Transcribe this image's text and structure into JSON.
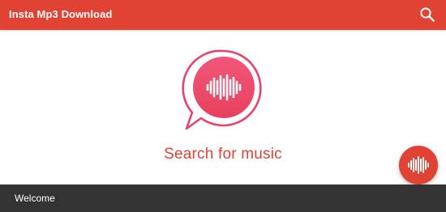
{
  "app": {
    "title": "Insta Mp3 Download",
    "accent_color": "#e04234"
  },
  "toolbar": {
    "search_icon": "search-icon"
  },
  "main": {
    "hero_icon": "music-waveform-chat-bubble-icon",
    "search_prompt": "Search for music"
  },
  "fab": {
    "icon": "waveform-icon"
  },
  "snackbar": {
    "message": "Welcome"
  }
}
